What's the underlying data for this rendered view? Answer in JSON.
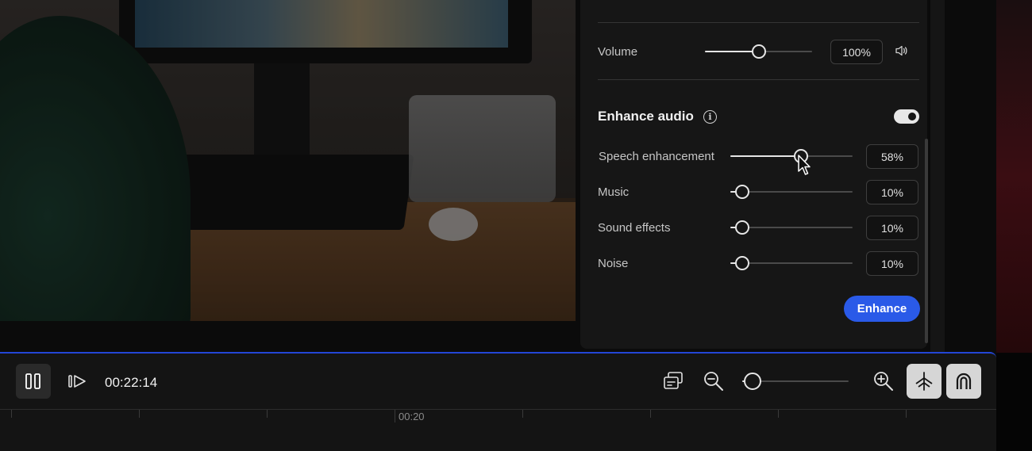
{
  "audio_panel": {
    "volume": {
      "label": "Volume",
      "value": "100%",
      "level": 0.5
    },
    "enhance": {
      "title": "Enhance audio",
      "toggle_on": true,
      "rows": [
        {
          "label": "Speech enhancement",
          "value": "58%",
          "level": 0.58
        },
        {
          "label": "Music",
          "value": "10%",
          "level": 0.1
        },
        {
          "label": "Sound effects",
          "value": "10%",
          "level": 0.1
        },
        {
          "label": "Noise",
          "value": "10%",
          "level": 0.1
        }
      ],
      "button_label": "Enhance"
    }
  },
  "transport": {
    "timecode": "00:22:14",
    "ruler_label": "00:20",
    "zoom_level": 0.1
  },
  "colors": {
    "accent": "#2a5ae8",
    "panel_bg": "#161616"
  },
  "icons": [
    "speaker-icon",
    "info-icon",
    "pause-icon",
    "play-step-icon",
    "caption-icon",
    "zoom-out-icon",
    "zoom-in-icon",
    "split-tool-icon",
    "magnet-icon",
    "cursor-icon"
  ]
}
